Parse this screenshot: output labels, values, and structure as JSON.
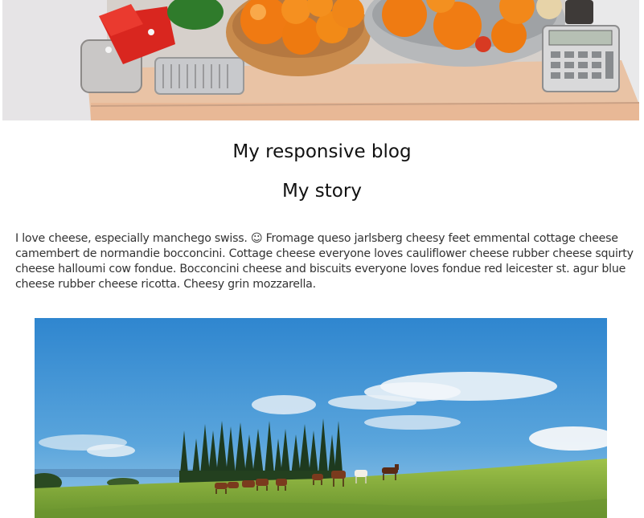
{
  "header_image": {
    "alt": "",
    "icon": "kitchen-counter-photo"
  },
  "blog": {
    "title": "My responsive blog",
    "story_heading": "My story",
    "story_text": "I love cheese, especially manchego swiss. ☺ Fromage queso jarlsberg cheesy feet emmental cottage cheese camembert de normandie bocconcini. Cottage cheese everyone loves cauliflower cheese rubber cheese squirty cheese halloumi cow fondue. Bocconcini cheese and biscuits everyone loves fondue red leicester st. agur blue cheese rubber cheese ricotta. Cheesy grin mozzarella."
  },
  "landscape_image": {
    "alt": "",
    "icon": "horses-meadow-photo"
  },
  "colors": {
    "text": "#333333",
    "heading": "#111111",
    "background": "#ffffff"
  }
}
